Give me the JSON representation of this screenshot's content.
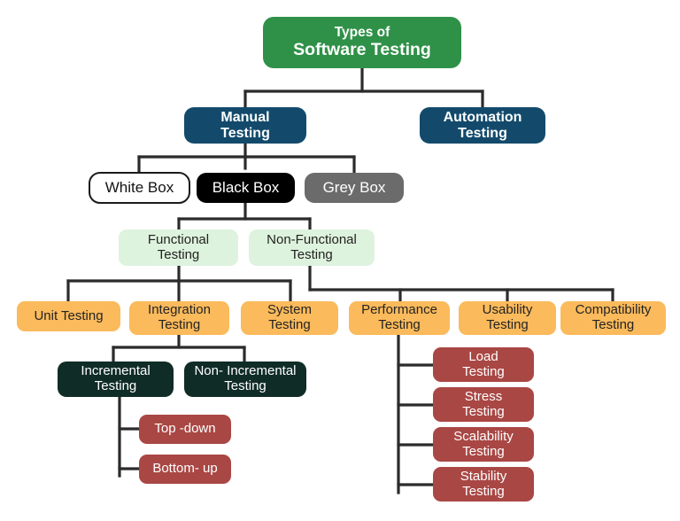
{
  "diagram": {
    "title": "Types of Software Testing",
    "type": "tree-hierarchy",
    "colors": {
      "root_green": "#2F9148",
      "navy": "#134A6B",
      "white_box": "#FFFFFF",
      "black_box": "#000000",
      "grey_box": "#6B6B6B",
      "mint": "#DEF3DE",
      "orange": "#FBBA5B",
      "dark_green": "#102C26",
      "red": "#A94744",
      "connector": "#2B2B2B",
      "background": "#FFFFFF"
    }
  },
  "nodes": {
    "root": {
      "line1": "Types of",
      "line2": "Software Testing"
    },
    "manual": {
      "label": "Manual\nTesting"
    },
    "automation": {
      "label": "Automation\nTesting"
    },
    "white_box": {
      "label": "White Box"
    },
    "black_box": {
      "label": "Black Box"
    },
    "grey_box": {
      "label": "Grey Box"
    },
    "functional": {
      "label": "Functional\nTesting"
    },
    "non_functional": {
      "label": "Non-Functional\nTesting"
    },
    "unit": {
      "label": "Unit Testing"
    },
    "integration": {
      "label": "Integration\nTesting"
    },
    "system": {
      "label": "System\nTesting"
    },
    "performance": {
      "label": "Performance\nTesting"
    },
    "usability": {
      "label": "Usability\nTesting"
    },
    "compatibility": {
      "label": "Compatibility\nTesting"
    },
    "incremental": {
      "label": "Incremental\nTesting"
    },
    "non_incremental": {
      "label": "Non- Incremental\nTesting"
    },
    "top_down": {
      "label": "Top -down"
    },
    "bottom_up": {
      "label": "Bottom- up"
    },
    "load": {
      "label": "Load\nTesting"
    },
    "stress": {
      "label": "Stress\nTesting"
    },
    "scalability": {
      "label": "Scalability\nTesting"
    },
    "stability": {
      "label": "Stability\nTesting"
    }
  }
}
